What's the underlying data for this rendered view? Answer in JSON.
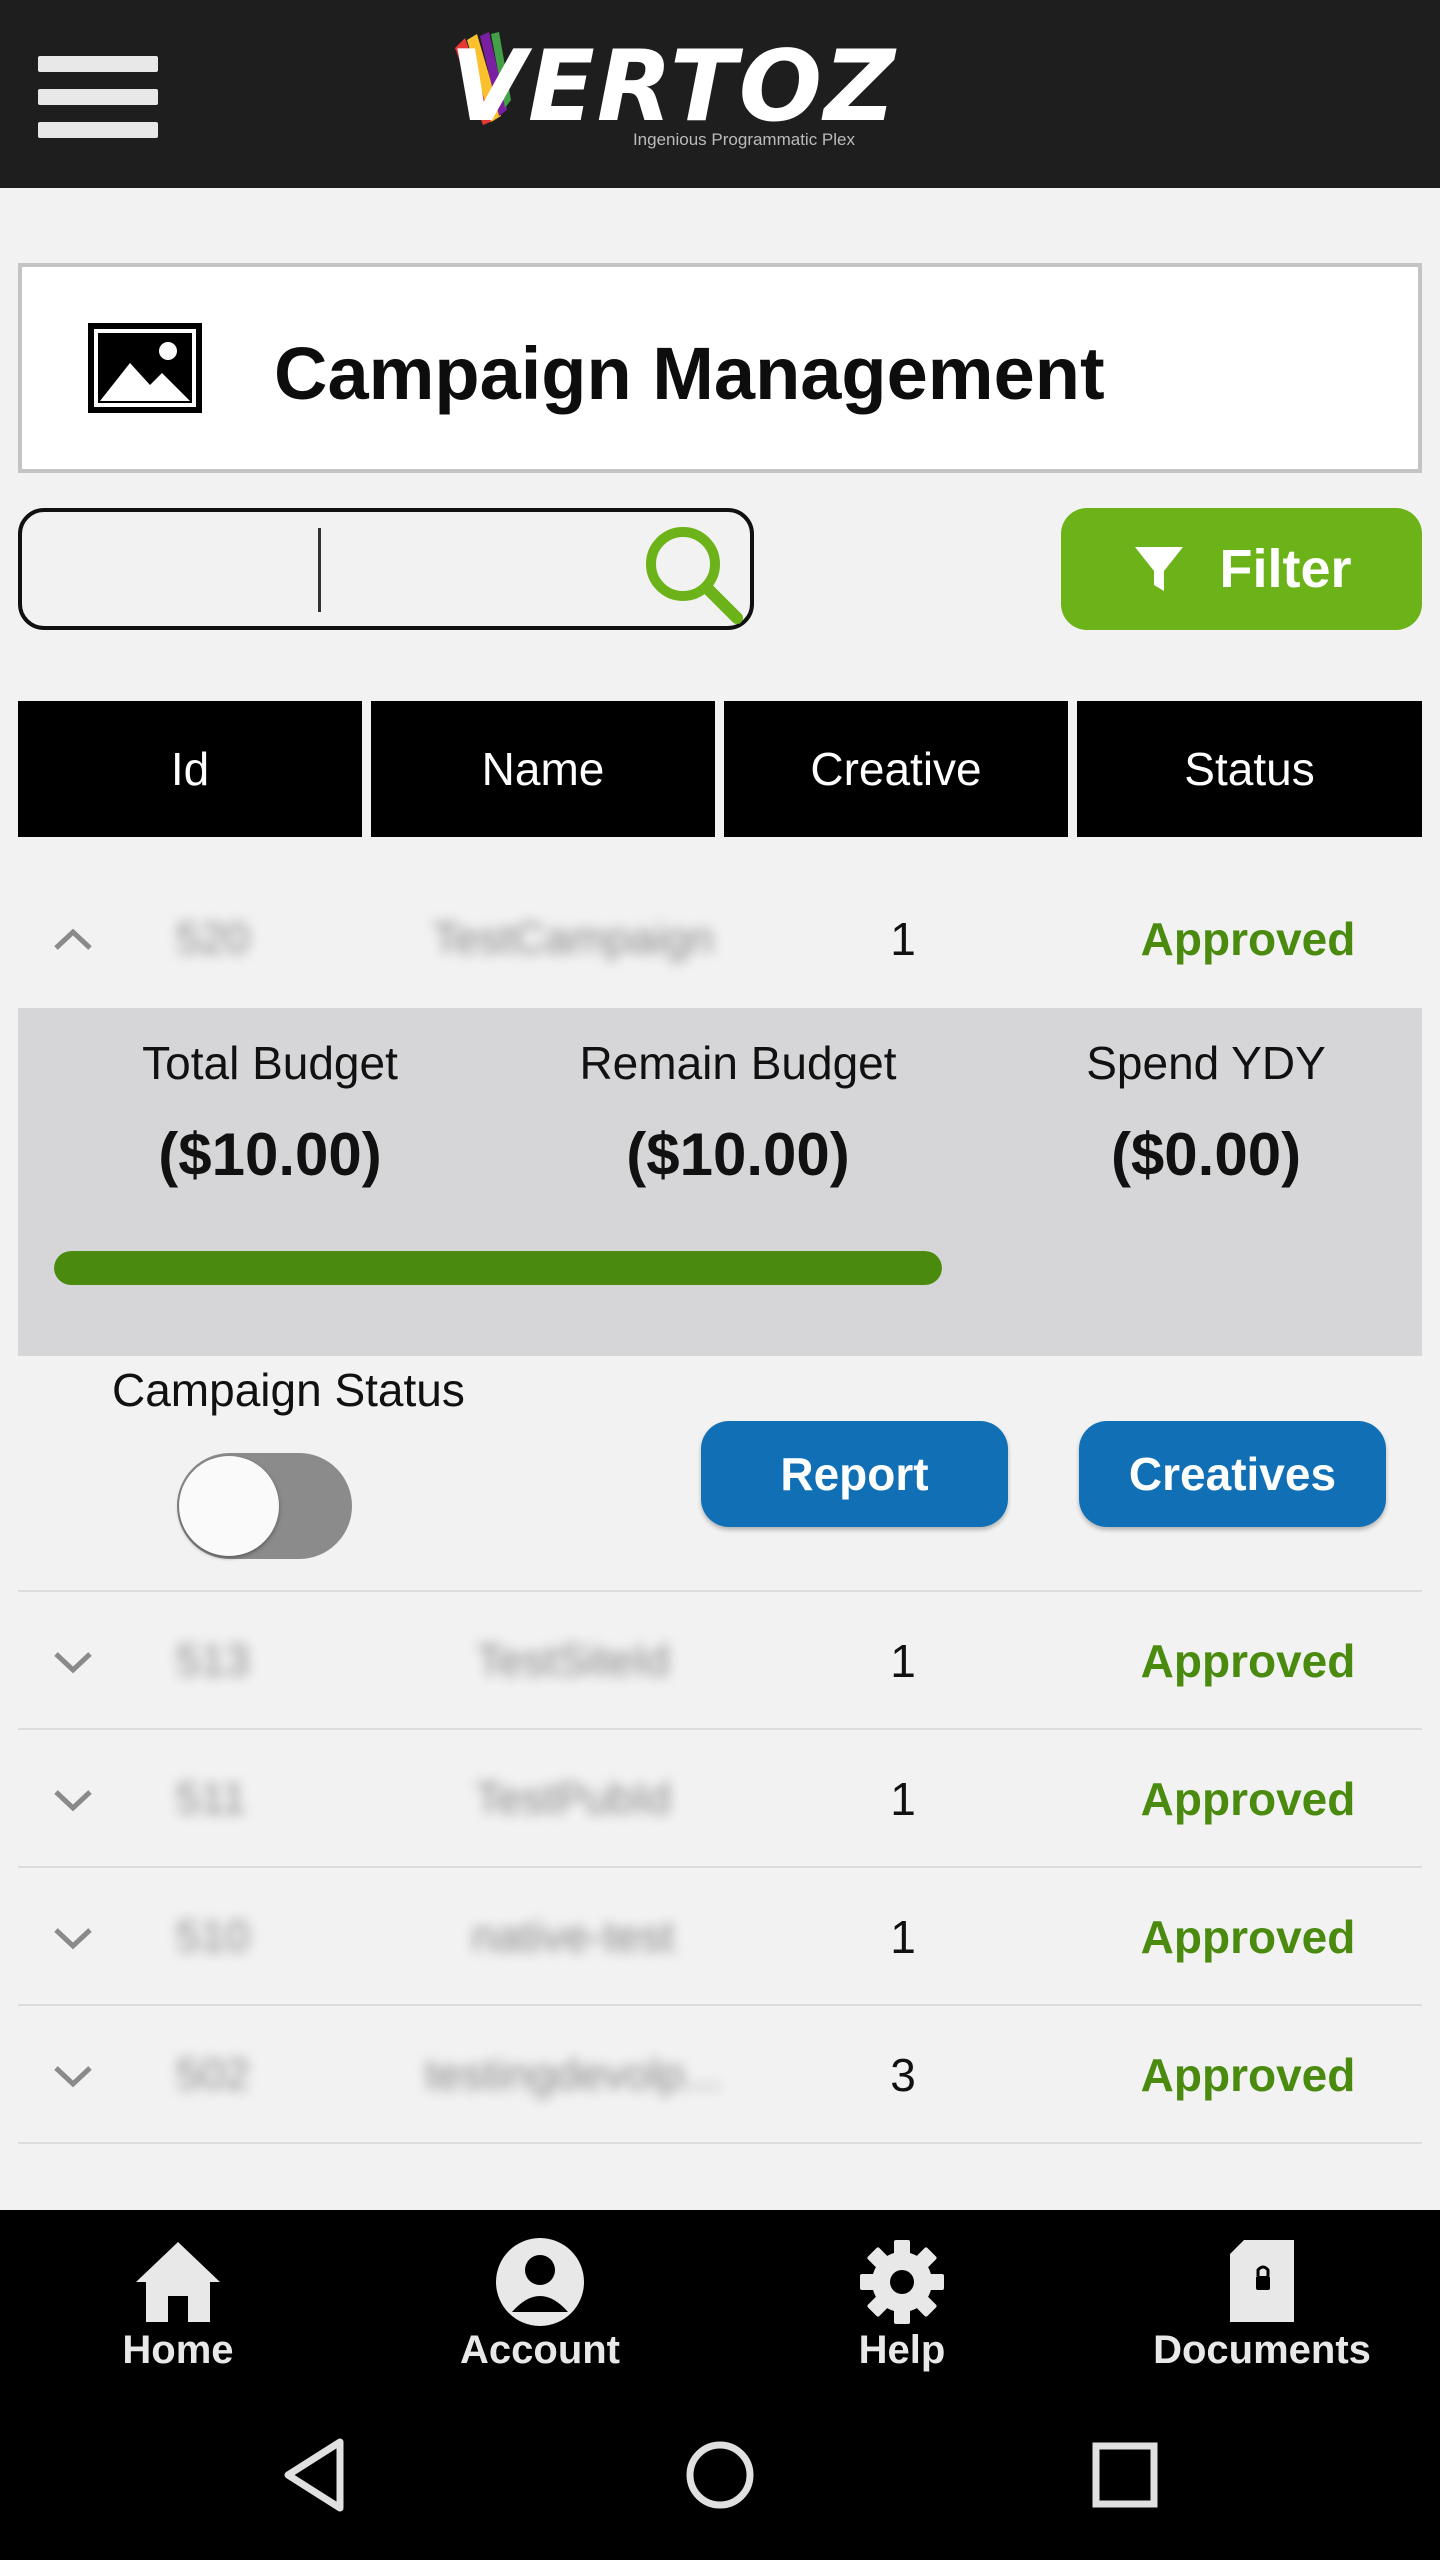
{
  "app": {
    "logo_text": "VERTOZ",
    "logo_tagline": "Ingenious Programmatic Plex"
  },
  "page": {
    "title": "Campaign Management"
  },
  "search": {
    "value": "",
    "placeholder": ""
  },
  "filter": {
    "label": "Filter"
  },
  "table": {
    "headers": [
      "Id",
      "Name",
      "Creative",
      "Status"
    ],
    "rows": [
      {
        "id": "520",
        "name": "TestCampaign",
        "creative": "1",
        "status": "Approved",
        "expanded": true
      },
      {
        "id": "513",
        "name": "TestSiteId",
        "creative": "1",
        "status": "Approved",
        "expanded": false
      },
      {
        "id": "511",
        "name": "TestPubId",
        "creative": "1",
        "status": "Approved",
        "expanded": false
      },
      {
        "id": "510",
        "name": "native-test",
        "creative": "1",
        "status": "Approved",
        "expanded": false
      },
      {
        "id": "502",
        "name": "testingdevolp...",
        "creative": "3",
        "status": "Approved",
        "expanded": false
      }
    ]
  },
  "details": {
    "total_budget_label": "Total Budget",
    "total_budget_value": "($10.00)",
    "remain_budget_label": "Remain Budget",
    "remain_budget_value": "($10.00)",
    "spend_ydy_label": "Spend YDY",
    "spend_ydy_value": "($0.00)",
    "remaining_fraction": 1.0,
    "campaign_status_label": "Campaign Status",
    "campaign_status_on": false,
    "report_label": "Report",
    "creatives_label": "Creatives"
  },
  "bottom_nav": {
    "items": [
      {
        "label": "Home",
        "icon": "home-icon"
      },
      {
        "label": "Account",
        "icon": "account-icon"
      },
      {
        "label": "Help",
        "icon": "gear-icon"
      },
      {
        "label": "Documents",
        "icon": "document-icon"
      }
    ]
  },
  "colors": {
    "accent_green": "#6bb318",
    "status_green": "#4a8a0e",
    "button_blue": "#1170b5",
    "header_black": "#000000"
  }
}
